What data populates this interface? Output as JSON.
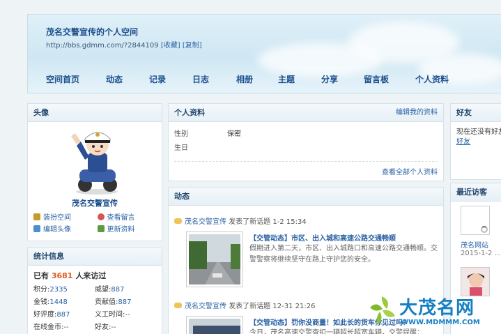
{
  "header": {
    "title": "茂名交警宣传的个人空间",
    "url": "http://bbs.gdmm.com/?2844109",
    "favorite": "[收藏]",
    "copy": "[复制]"
  },
  "nav": [
    "空间首页",
    "动态",
    "记录",
    "日志",
    "相册",
    "主题",
    "分享",
    "留言板",
    "个人资料"
  ],
  "avatar_panel": {
    "title": "头像",
    "user_name": "茂名交警宣传",
    "actions": [
      {
        "label": "装扮空间",
        "icon": "brush-icon",
        "color": "#c79a2c"
      },
      {
        "label": "查看留言",
        "icon": "search-icon",
        "color": "#d9534f"
      },
      {
        "label": "编辑头像",
        "icon": "user-icon",
        "color": "#4a8fd1"
      },
      {
        "label": "更新资料",
        "icon": "doc-icon",
        "color": "#5a9c3e"
      }
    ]
  },
  "stats": {
    "title": "统计信息",
    "visits_prefix": "已有",
    "visits": "3681",
    "visits_suffix": "人来访过",
    "rows": [
      [
        {
          "k": "积分:",
          "v": "2335"
        },
        {
          "k": "威望:",
          "v": "887"
        }
      ],
      [
        {
          "k": "金钱:",
          "v": "1448"
        },
        {
          "k": "贡献值:",
          "v": "887"
        }
      ],
      [
        {
          "k": "好评度:",
          "v": "887"
        },
        {
          "k": "义工时间:",
          "v": "--"
        }
      ],
      [
        {
          "k": "在线金币:",
          "v": "--"
        },
        {
          "k": "好友:",
          "v": "--"
        }
      ]
    ]
  },
  "profile": {
    "title": "个人资料",
    "edit": "编辑我的资料",
    "rows": [
      {
        "k": "性别",
        "v": "保密"
      },
      {
        "k": "生日",
        "v": ""
      }
    ],
    "view_all": "查看全部个人资料"
  },
  "feed": {
    "title": "动态",
    "items": [
      {
        "who": "茂名交警宣传",
        "action": "发表了新话题",
        "time": "1-2 15:34",
        "title": "【交管动态】市区、出入城和高速公路交通畅顺",
        "text": "假期进入第二天，市区、出入城路口和高速公路交通畅顺。交警警察将继续坚守在路上守护您的安全。"
      },
      {
        "who": "茂名交警宣传",
        "action": "发表了新话题",
        "time": "12-31 21:26",
        "title": "【交管动态】罚你没商量！如此长的货车你见过吗？",
        "text": "今日，茂名高速交警查扣一辆超长超宽车辆，交警提醒："
      }
    ]
  },
  "friends": {
    "title": "好友",
    "text": "现在还没有好友",
    "link": "好友"
  },
  "visitors": {
    "title": "最近访客",
    "items": [
      {
        "name": "茂名网站",
        "date": "2015-1-2 ..."
      },
      {
        "name": "",
        "date": ""
      }
    ]
  },
  "watermark": {
    "cn": "大茂名网",
    "url": "WWW.MDMMM.COM"
  }
}
